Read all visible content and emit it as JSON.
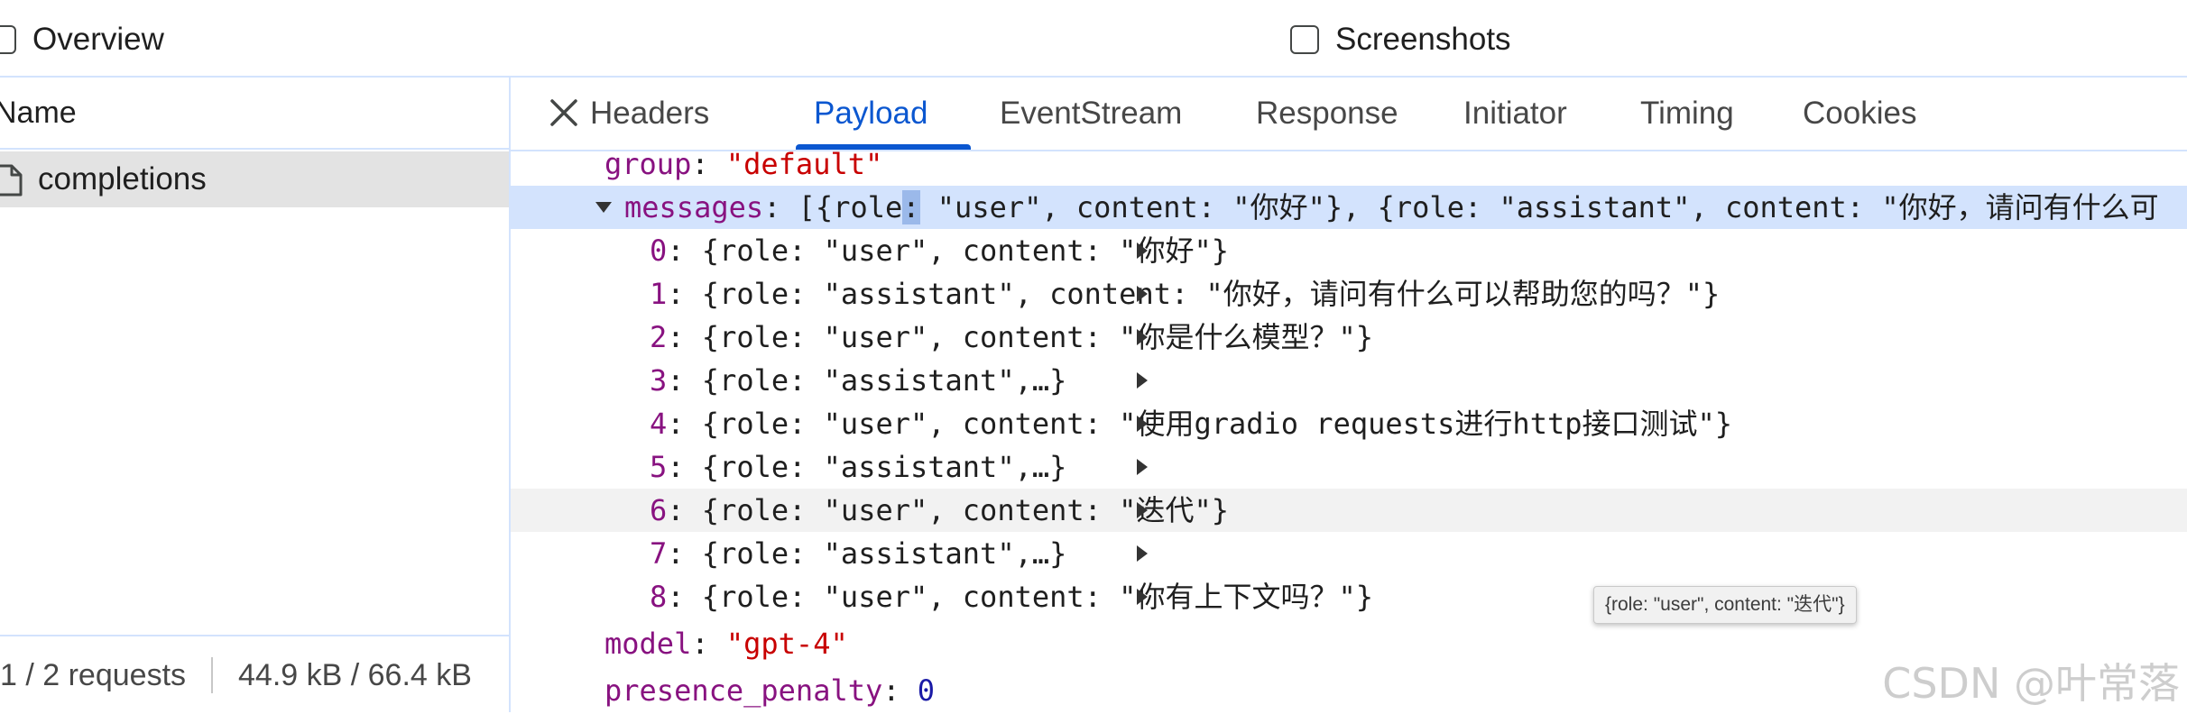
{
  "options": {
    "overview_label": "Overview",
    "screenshots_label": "Screenshots"
  },
  "request_list": {
    "column_header": "Name",
    "items": [
      {
        "name": "completions",
        "selected": true
      }
    ]
  },
  "status_bar": {
    "requests": "1 / 2 requests",
    "transferred": "44.9 kB / 66.4 kB"
  },
  "tabs": [
    {
      "label": "Headers",
      "active": false
    },
    {
      "label": "Payload",
      "active": true
    },
    {
      "label": "EventStream",
      "active": false
    },
    {
      "label": "Response",
      "active": false
    },
    {
      "label": "Initiator",
      "active": false
    },
    {
      "label": "Timing",
      "active": false
    },
    {
      "label": "Cookies",
      "active": false
    }
  ],
  "payload": {
    "group_key": "group",
    "group_value": "\"default\"",
    "messages_key": "messages",
    "messages_preview_a": "[{role",
    "messages_preview_colon": ":",
    "messages_preview_b": " \"user\", content: \"你好\"}, {role: \"assistant\", content: \"你好，请问有什么可",
    "messages": [
      {
        "index": "0",
        "text": "{role: \"user\", content: \"你好\"}"
      },
      {
        "index": "1",
        "text": "{role: \"assistant\", content: \"你好，请问有什么可以帮助您的吗？\"}"
      },
      {
        "index": "2",
        "text": "{role: \"user\", content: \"你是什么模型？\"}"
      },
      {
        "index": "3",
        "text": "{role: \"assistant\",…}"
      },
      {
        "index": "4",
        "text": "{role: \"user\", content: \"使用gradio requests进行http接口测试\"}"
      },
      {
        "index": "5",
        "text": "{role: \"assistant\",…}"
      },
      {
        "index": "6",
        "text": "{role: \"user\", content: \"迭代\"}"
      },
      {
        "index": "7",
        "text": "{role: \"assistant\",…}"
      },
      {
        "index": "8",
        "text": "{role: \"user\", content: \"你有上下文吗？\"}"
      }
    ],
    "model_key": "model",
    "model_value": "\"gpt-4\"",
    "presence_key": "presence_penalty",
    "presence_value": "0"
  },
  "tooltip": "{role: \"user\", content: \"迭代\"}",
  "watermark": "CSDN @叶常落",
  "colors": {
    "accent": "#0b57d0",
    "selected_row": "#d3e3fd",
    "key": "#881280",
    "string": "#c80000",
    "number": "#1a1aa6"
  }
}
